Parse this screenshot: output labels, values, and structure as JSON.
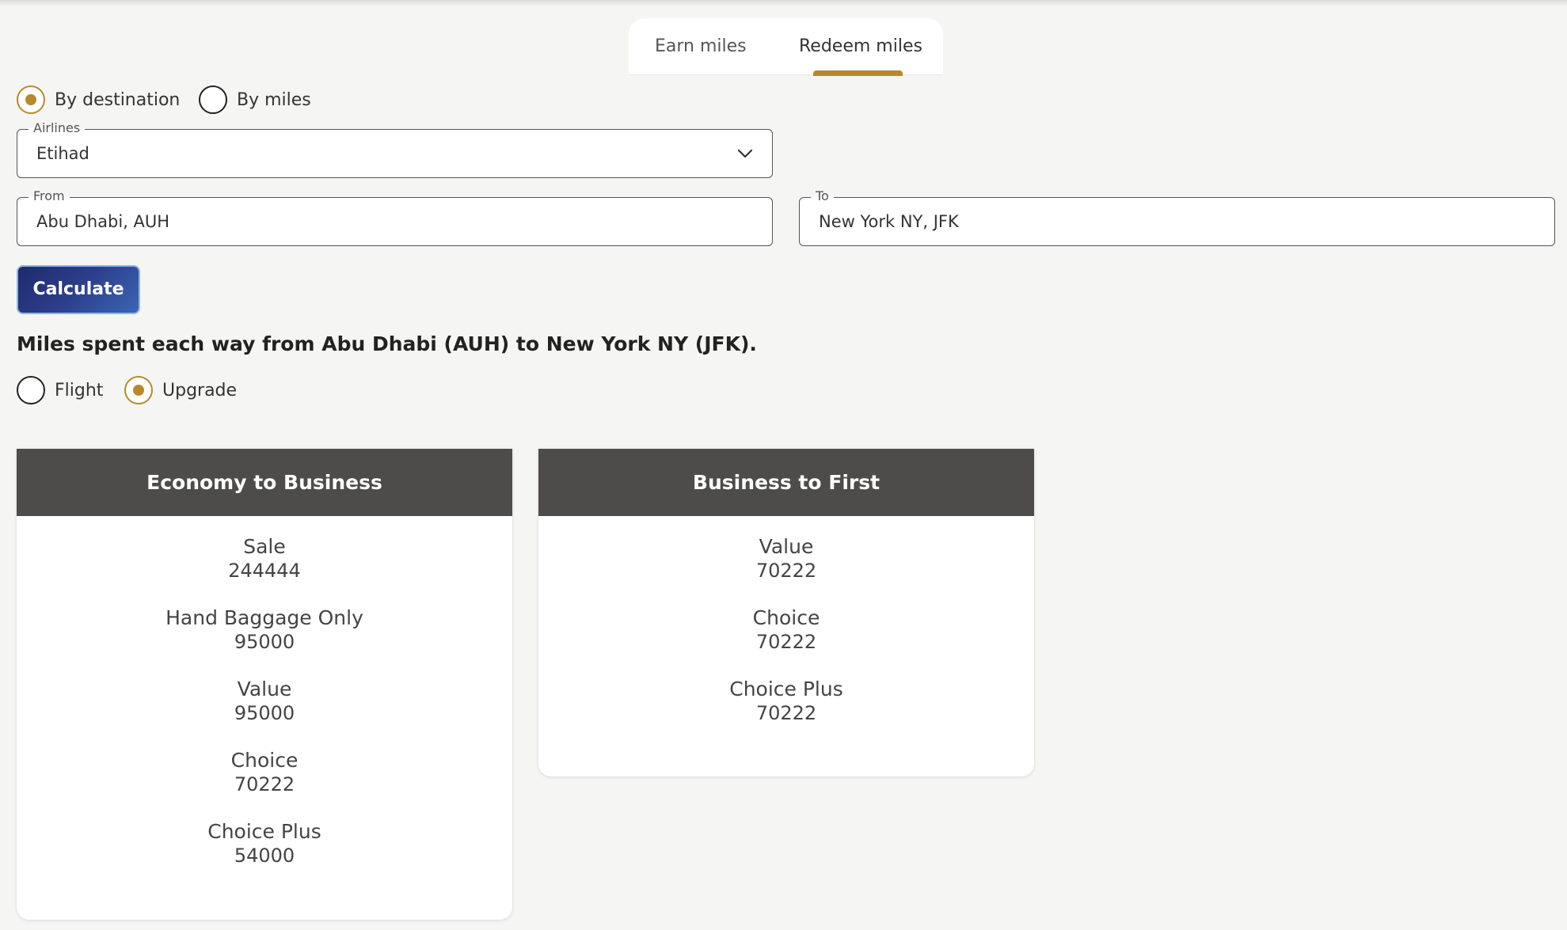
{
  "tabs": [
    {
      "label": "Earn miles"
    },
    {
      "label": "Redeem miles",
      "active": true
    }
  ],
  "search_mode": {
    "options": [
      "By destination",
      "By miles"
    ],
    "selected": "By destination"
  },
  "airlines": {
    "label": "Airlines",
    "value": "Etihad"
  },
  "from": {
    "label": "From",
    "value": "Abu Dhabi, AUH"
  },
  "to": {
    "label": "To",
    "value": "New York NY, JFK"
  },
  "calculate_label": "Calculate",
  "summary": "Miles spent each way from Abu Dhabi (AUH) to New York NY (JFK).",
  "type": {
    "options": [
      "Flight",
      "Upgrade"
    ],
    "selected": "Upgrade"
  },
  "cards": [
    {
      "title": "Economy to Business",
      "fares": [
        {
          "name": "Sale",
          "miles": "244444"
        },
        {
          "name": "Hand Baggage Only",
          "miles": "95000"
        },
        {
          "name": "Value",
          "miles": "95000"
        },
        {
          "name": "Choice",
          "miles": "70222"
        },
        {
          "name": "Choice Plus",
          "miles": "54000"
        }
      ]
    },
    {
      "title": "Business to First",
      "fares": [
        {
          "name": "Value",
          "miles": "70222"
        },
        {
          "name": "Choice",
          "miles": "70222"
        },
        {
          "name": "Choice Plus",
          "miles": "70222"
        }
      ]
    }
  ],
  "colors": {
    "accent": "#b8892c",
    "header": "#4d4c4a",
    "button": "#1f2a6b"
  }
}
